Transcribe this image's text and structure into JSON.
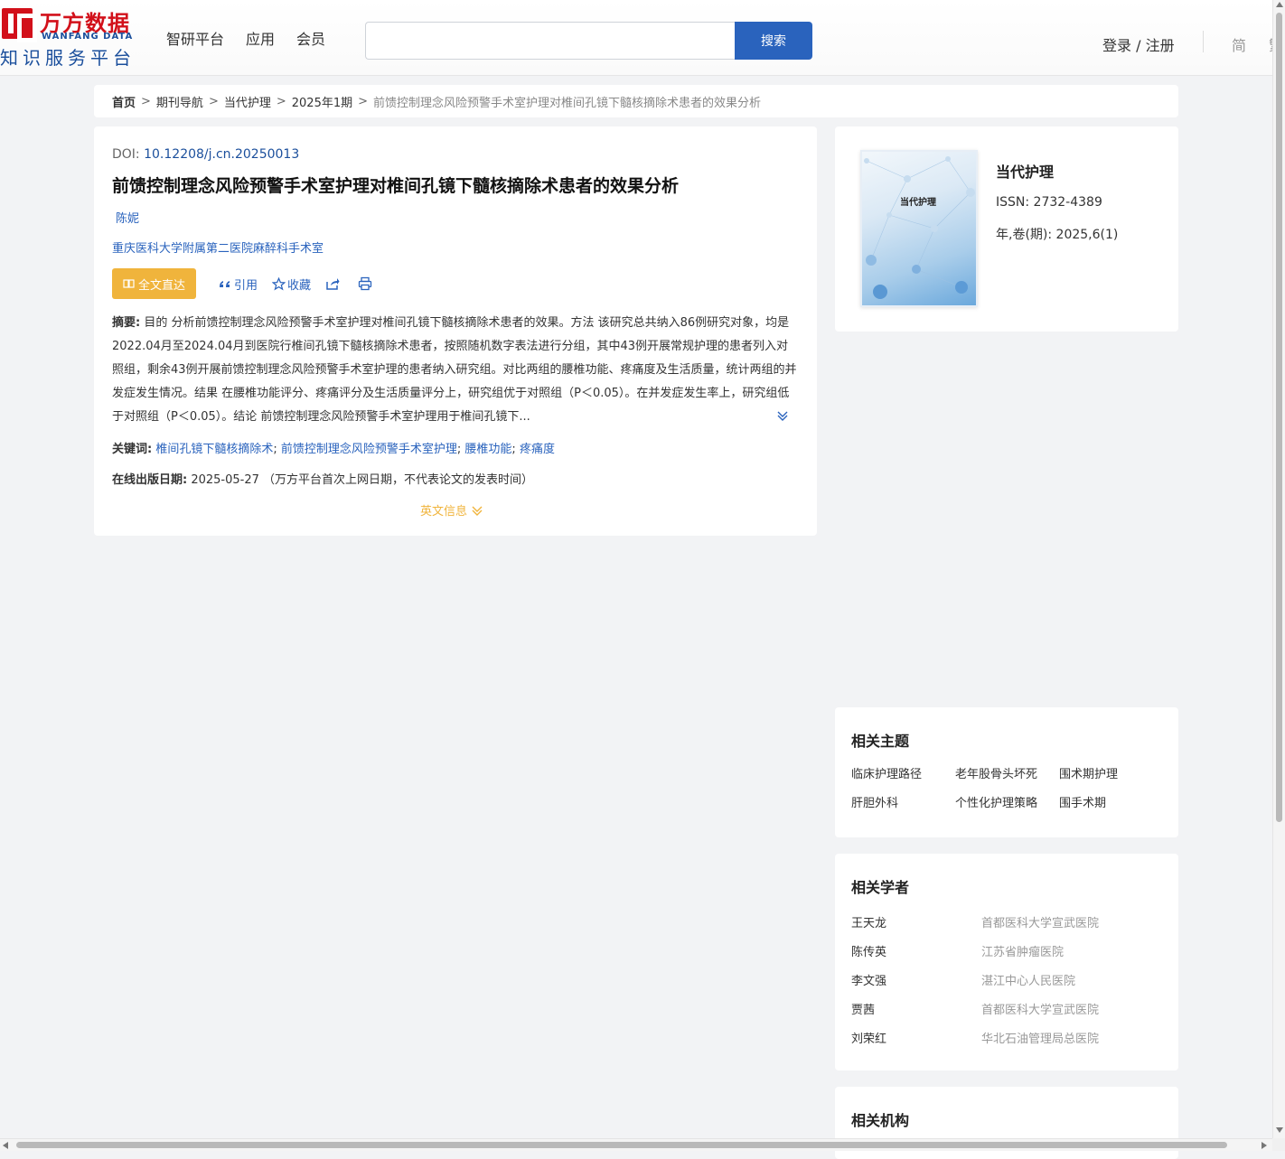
{
  "header": {
    "logo_cn": "万方数据",
    "logo_en": "WANFANG DATA",
    "logo_sub": "知识服务平台",
    "nav": [
      "智研平台",
      "应用",
      "会员"
    ],
    "search_value": "",
    "search_button": "搜索",
    "login": "登录 / 注册",
    "lang": "简",
    "lang2": "繁"
  },
  "breadcrumb": {
    "items": [
      "首页",
      "期刊导航",
      "当代护理",
      "2025年1期"
    ],
    "sep": ">",
    "current": "前馈控制理念风险预警手术室护理对椎间孔镜下髓核摘除术患者的效果分析"
  },
  "article": {
    "doi_label": "DOI:",
    "doi": "10.12208/j.cn.20250013",
    "title": "前馈控制理念风险预警手术室护理对椎间孔镜下髓核摘除术患者的效果分析",
    "author": "陈妮",
    "org": "重庆医科大学附属第二医院麻醉科手术室",
    "actions": {
      "fulltext": "全文直达",
      "cite": "引用",
      "favorite": "收藏"
    },
    "abstract_label": "摘要:",
    "abstract": "目的 分析前馈控制理念风险预警手术室护理对椎间孔镜下髓核摘除术患者的效果。方法 该研究总共纳入86例研究对象，均是2022.04月至2024.04月到医院行椎间孔镜下髓核摘除术患者，按照随机数字表法进行分组，其中43例开展常规护理的患者列入对照组，剩余43例开展前馈控制理念风险预警手术室护理的患者纳入研究组。对比两组的腰椎功能、疼痛度及生活质量，统计两组的并发症发生情况。结果 在腰椎功能评分、疼痛评分及生活质量评分上，研究组优于对照组（P＜0.05）。在并发症发生率上，研究组低于对照组（P＜0.05）。结论 前馈控制理念风险预警手术室护理用于椎间孔镜下...",
    "keywords_label": "关键词:",
    "keywords": [
      "椎间孔镜下髓核摘除术",
      "前馈控制理念风险预警手术室护理",
      "腰椎功能",
      "疼痛度"
    ],
    "pubdate_label": "在线出版日期:",
    "pubdate": "2025-05-27",
    "pubdate_note": "（万方平台首次上网日期，不代表论文的发表时间）",
    "english_info": "英文信息"
  },
  "journal": {
    "cover_title": "当代护理",
    "name": "当代护理",
    "issn_label": "ISSN:",
    "issn": "2732-4389",
    "year_label": "年,卷(期):",
    "year": "2025,6(1)"
  },
  "related_topics": {
    "title": "相关主题",
    "items": [
      "临床护理路径",
      "老年股骨头坏死",
      "围术期护理",
      "肝胆外科",
      "个性化护理策略",
      "围手术期"
    ]
  },
  "related_scholars": {
    "title": "相关学者",
    "items": [
      {
        "name": "王天龙",
        "affiliation": "首都医科大学宣武医院"
      },
      {
        "name": "陈传英",
        "affiliation": "江苏省肿瘤医院"
      },
      {
        "name": "李文强",
        "affiliation": "湛江中心人民医院"
      },
      {
        "name": "贾茜",
        "affiliation": "首都医科大学宣武医院"
      },
      {
        "name": "刘荣红",
        "affiliation": "华北石油管理局总医院"
      }
    ]
  },
  "related_institutions": {
    "title": "相关机构"
  },
  "colors": {
    "brand_red": "#d2101a",
    "brand_blue": "#1b4f9c",
    "link_blue": "#2a63bd",
    "accent_orange": "#f0b43c"
  }
}
